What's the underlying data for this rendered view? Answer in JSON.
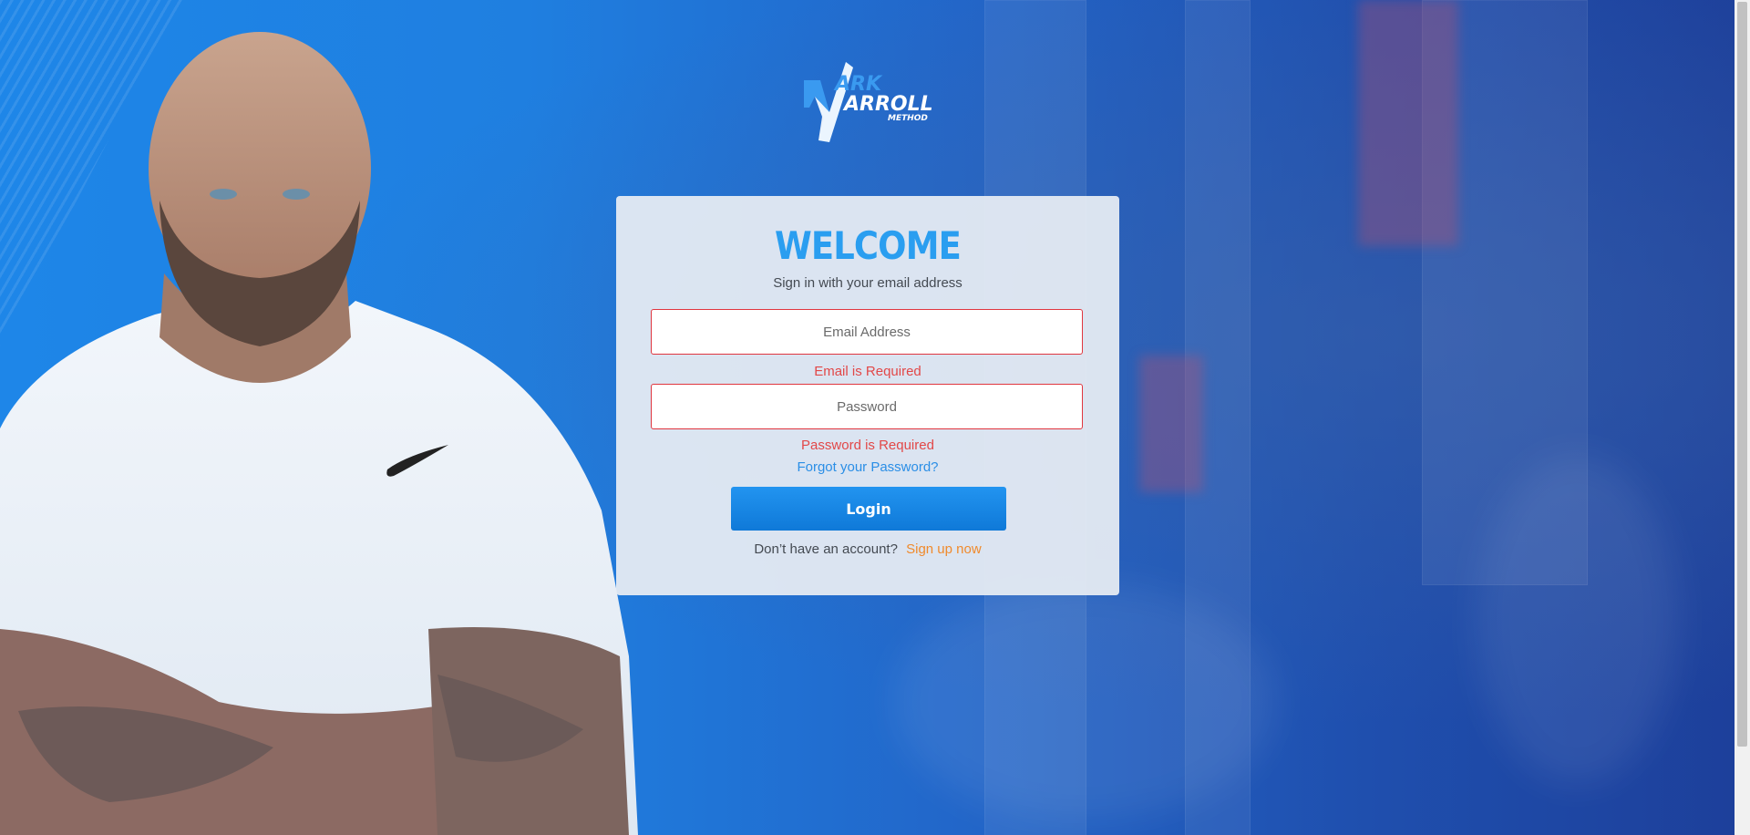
{
  "logo": {
    "line1": "ARK",
    "line2": "ARROLL",
    "line3": "METHOD",
    "brand_color": "#3a9af0"
  },
  "card": {
    "title": "WELCOME",
    "subtitle": "Sign in with your email address",
    "email": {
      "value": "",
      "placeholder": "Email Address",
      "error": "Email is Required"
    },
    "password": {
      "value": "",
      "placeholder": "Password",
      "error": "Password is Required"
    },
    "forgot_link": "Forgot your Password?",
    "login_label": "Login",
    "signup_question": "Don’t have an account?",
    "signup_link": "Sign up now"
  },
  "colors": {
    "accent": "#2a9ef0",
    "error": "#e24848",
    "signup": "#f08a2c",
    "button": "#1585e4"
  }
}
